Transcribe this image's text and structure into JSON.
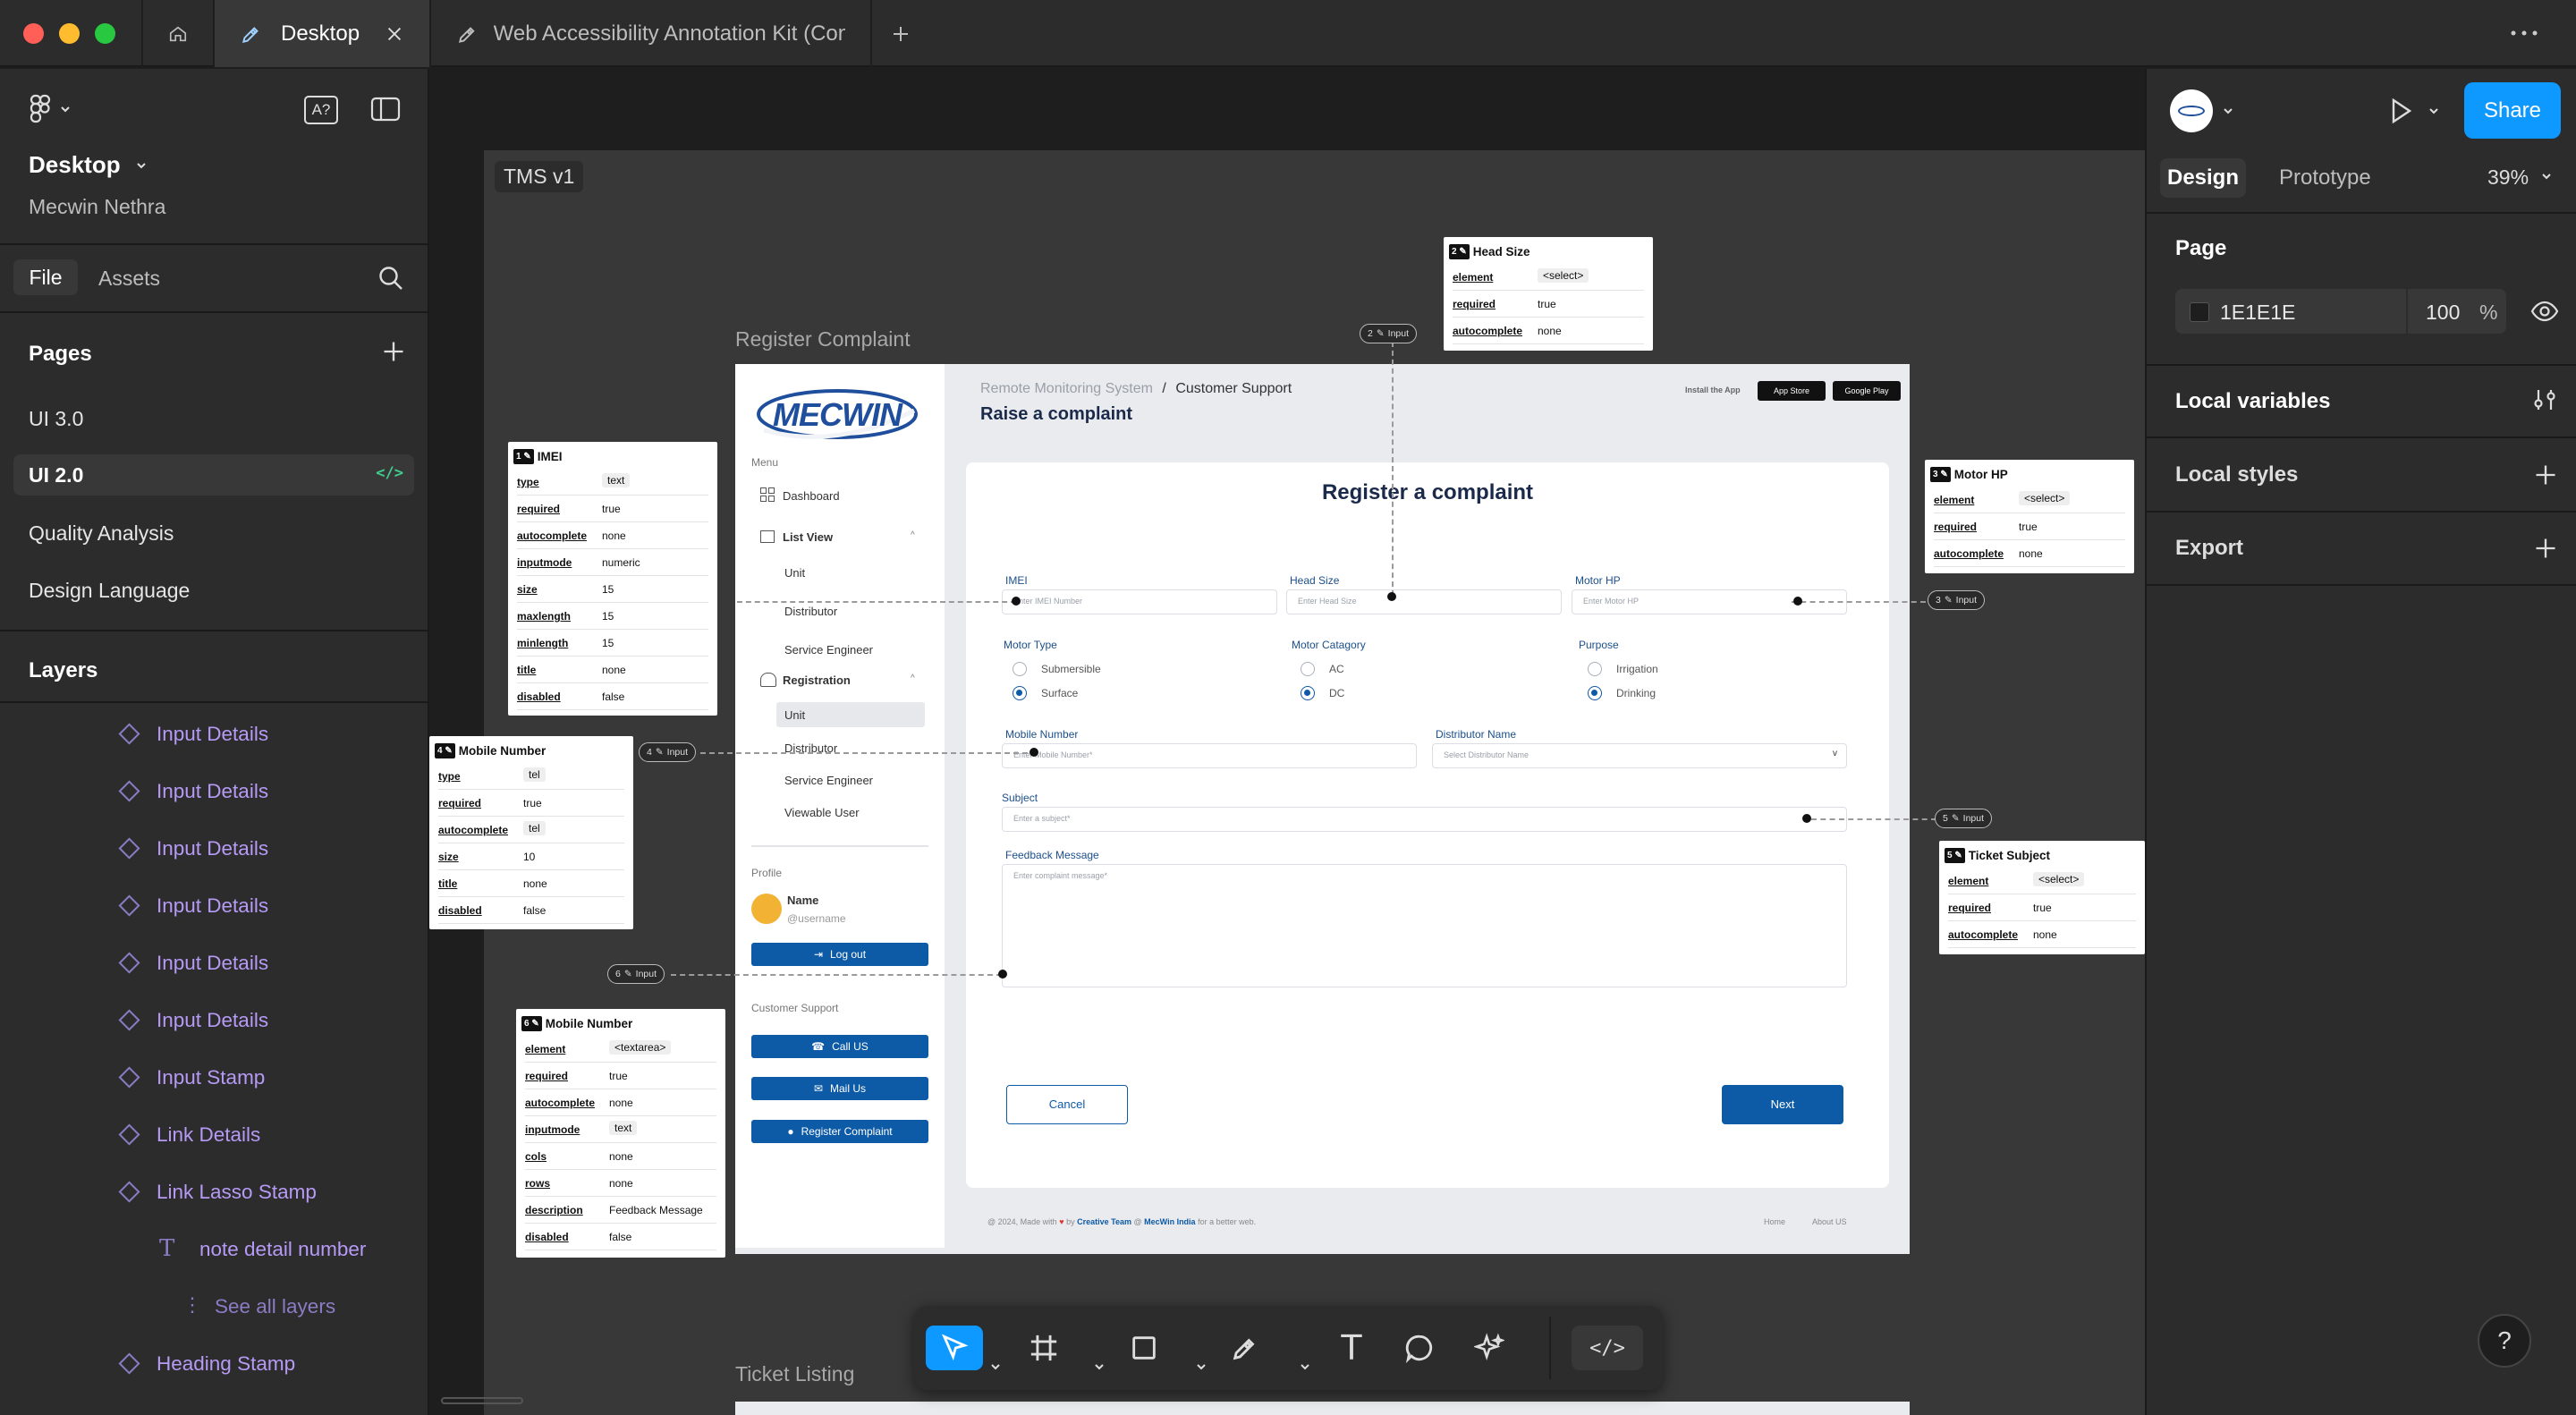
{
  "tabs": {
    "desktop": "Desktop",
    "kit": "Web Accessibility Annotation Kit (Con"
  },
  "left": {
    "file_name": "Desktop",
    "team": "Mecwin Nethra",
    "tab_file": "File",
    "tab_assets": "Assets",
    "pages_title": "Pages",
    "pages": [
      "UI 3.0",
      "UI 2.0",
      "Quality Analysis",
      "Design Language"
    ],
    "layers_title": "Layers",
    "layers": [
      "Input Details",
      "Input Details",
      "Input Details",
      "Input Details",
      "Input Details",
      "Input Details",
      "Input Stamp",
      "Link Details",
      "Link Lasso Stamp"
    ],
    "text_layer": "note detail number",
    "see_all": "See all layers",
    "heading_stamp": "Heading Stamp"
  },
  "right": {
    "share": "Share",
    "tab_design": "Design",
    "tab_prototype": "Prototype",
    "zoom": "39%",
    "page_title": "Page",
    "page_color": "1E1E1E",
    "page_opacity": "100",
    "percent": "%",
    "local_variables": "Local variables",
    "local_styles": "Local styles",
    "export": "Export"
  },
  "canvas": {
    "frame_name": "TMS v1",
    "register_label": "Register Complaint",
    "ticket_label": "Ticket Listing"
  },
  "screen": {
    "logo": "MECWIN",
    "breadcrumb_1": "Remote Monitoring System",
    "breadcrumb_sep": "/",
    "breadcrumb_2": "Customer Support",
    "page_heading": "Raise a complaint",
    "install": "Install the App",
    "app_store": "App Store",
    "google_play": "Google Play",
    "menu": "Menu",
    "dashboard": "Dashboard",
    "list_view": "List View",
    "unit": "Unit",
    "distributor": "Distributor",
    "service_engineer": "Service Engineer",
    "registration": "Registration",
    "unit2": "Unit",
    "distributor2": "Distributor",
    "service_engineer2": "Service Engineer",
    "viewable_user": "Viewable User",
    "profile": "Profile",
    "name": "Name",
    "username": "@username",
    "logout": "Log out",
    "customer_support": "Customer Support",
    "call_us": "Call US",
    "mail_us": "Mail Us",
    "register_complaint_btn": "Register Complaint",
    "form_title": "Register a complaint",
    "imei_label": "IMEI",
    "imei_ph": "Enter IMEI Number",
    "head_label": "Head Size",
    "head_ph": "Enter Head Size",
    "motorhp_label": "Motor HP",
    "motorhp_ph": "Enter Motor HP",
    "motor_type": "Motor Type",
    "submersible": "Submersible",
    "surface": "Surface",
    "motor_category": "Motor Catagory",
    "ac": "AC",
    "dc": "DC",
    "purpose": "Purpose",
    "irrigation": "Irrigation",
    "drinking": "Drinking",
    "mobile_label": "Mobile Number",
    "mobile_ph": "Enter Mobile Number*",
    "distname_label": "Distributor Name",
    "distname_ph": "Select Distributor Name",
    "subject_label": "Subject",
    "subject_ph": "Enter a subject*",
    "feedback_label": "Feedback Message",
    "feedback_ph": "Enter complaint message*",
    "cancel": "Cancel",
    "next": "Next",
    "footer_left_1": "@ 2024, Made with",
    "footer_left_2": "by",
    "footer_team": "Creative Team",
    "footer_at": "@",
    "footer_company": "MecWin India",
    "footer_left_3": "for a better web.",
    "footer_home": "Home",
    "footer_about": "About US"
  },
  "annotations": {
    "input": "Input",
    "imei": {
      "num": "1",
      "title": "IMEI",
      "rows": [
        [
          "type",
          "text"
        ],
        [
          "required",
          "true"
        ],
        [
          "autocomplete",
          "none"
        ],
        [
          "inputmode",
          "numeric"
        ],
        [
          "size",
          "15"
        ],
        [
          "maxlength",
          "15"
        ],
        [
          "minlength",
          "15"
        ],
        [
          "title",
          "none"
        ],
        [
          "disabled",
          "false"
        ]
      ]
    },
    "head": {
      "num": "2",
      "title": "Head Size",
      "rows": [
        [
          "element",
          "<select>"
        ],
        [
          "required",
          "true"
        ],
        [
          "autocomplete",
          "none"
        ]
      ]
    },
    "motor": {
      "num": "3",
      "title": "Motor HP",
      "rows": [
        [
          "element",
          "<select>"
        ],
        [
          "required",
          "true"
        ],
        [
          "autocomplete",
          "none"
        ]
      ]
    },
    "mobile": {
      "num": "4",
      "title": "Mobile Number",
      "rows": [
        [
          "type",
          "tel"
        ],
        [
          "required",
          "true"
        ],
        [
          "autocomplete",
          "tel"
        ],
        [
          "size",
          "10"
        ],
        [
          "title",
          "none"
        ],
        [
          "disabled",
          "false"
        ]
      ]
    },
    "subject": {
      "num": "5",
      "title": "Ticket Subject",
      "rows": [
        [
          "element",
          "<select>"
        ],
        [
          "required",
          "true"
        ],
        [
          "autocomplete",
          "none"
        ]
      ]
    },
    "message": {
      "num": "6",
      "title": "Mobile Number",
      "rows": [
        [
          "element",
          "<textarea>"
        ],
        [
          "required",
          "true"
        ],
        [
          "autocomplete",
          "none"
        ],
        [
          "inputmode",
          "text"
        ],
        [
          "cols",
          "none"
        ],
        [
          "rows",
          "none"
        ],
        [
          "description",
          "Feedback Message"
        ],
        [
          "disabled",
          "false"
        ]
      ]
    }
  },
  "colors": {
    "accent": "#0d99ff",
    "form_blue": "#0d5aa6",
    "layer_purple": "#b69af5"
  },
  "icons": [
    "home-icon",
    "pen-icon",
    "close-icon",
    "plus-icon",
    "more-icon",
    "figma-menu-icon",
    "text-size-icon",
    "panel-icon",
    "search-icon",
    "play-icon",
    "eye-icon",
    "variables-icon",
    "move-tool-icon",
    "frame-tool-icon",
    "shape-tool-icon",
    "pen-tool-icon",
    "text-tool-icon",
    "comment-tool-icon",
    "ai-tool-icon",
    "dev-mode-icon",
    "help-icon"
  ]
}
